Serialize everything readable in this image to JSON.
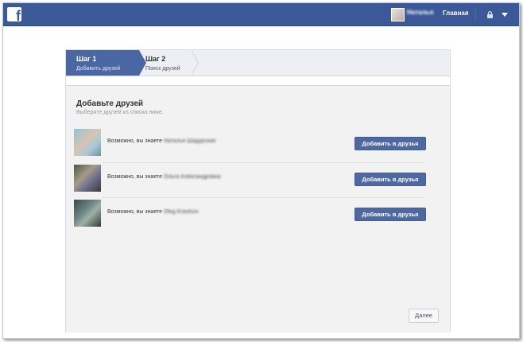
{
  "header": {
    "logo_letter": "f",
    "user_name": "Наталья",
    "home_label": "Главная",
    "colors": {
      "bar": "#3b5998"
    }
  },
  "steps": [
    {
      "title": "Шаг 1",
      "subtitle": "Добавить друзей",
      "active": true
    },
    {
      "title": "Шаг 2",
      "subtitle": "Поиск друзей",
      "active": false
    }
  ],
  "main": {
    "heading": "Добавьте друзей",
    "subheading": "Выберите друзей из списка ниже.",
    "suggestions": [
      {
        "prefix": "Возможно, вы знаете",
        "name": "Наталья Шадурская",
        "button": "Добавить в друзья"
      },
      {
        "prefix": "Возможно, вы знаете",
        "name": "Ольга Александровна",
        "button": "Добавить в друзья"
      },
      {
        "prefix": "Возможно, вы знаете",
        "name": "Oleg Kravtsov",
        "button": "Добавить в друзья"
      }
    ],
    "next_button": "Далее"
  },
  "icons": [
    "facebook-logo-icon",
    "lock-icon",
    "caret-down-icon"
  ]
}
